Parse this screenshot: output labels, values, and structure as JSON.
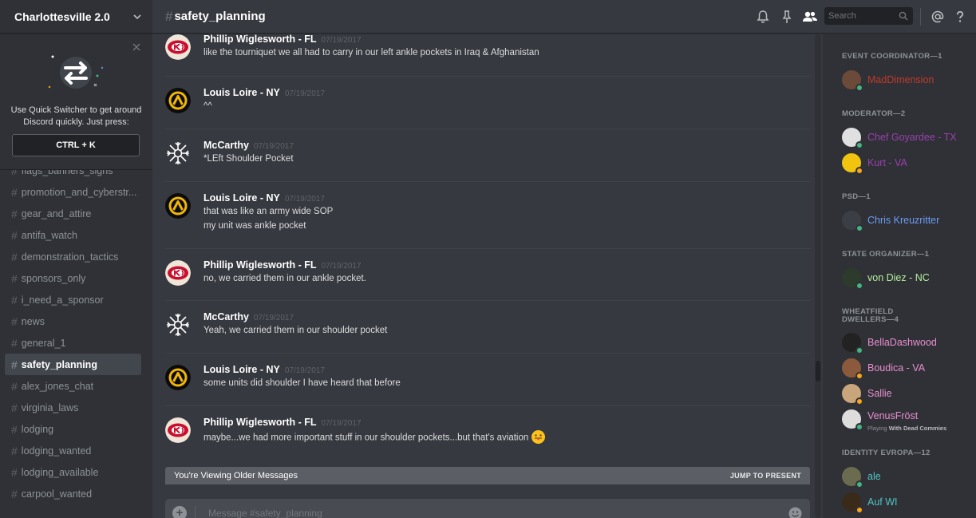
{
  "server": {
    "name": "Charlottesville 2.0"
  },
  "quick_switcher": {
    "text_line1": "Use Quick Switcher to get around",
    "text_line2": "Discord quickly. Just press:",
    "shortcut": "CTRL + K"
  },
  "channels": [
    {
      "name": "flags_banners_signs",
      "active": false
    },
    {
      "name": "promotion_and_cyberstr...",
      "active": false
    },
    {
      "name": "gear_and_attire",
      "active": false
    },
    {
      "name": "antifa_watch",
      "active": false
    },
    {
      "name": "demonstration_tactics",
      "active": false
    },
    {
      "name": "sponsors_only",
      "active": false
    },
    {
      "name": "i_need_a_sponsor",
      "active": false
    },
    {
      "name": "news",
      "active": false
    },
    {
      "name": "general_1",
      "active": false
    },
    {
      "name": "safety_planning",
      "active": true
    },
    {
      "name": "alex_jones_chat",
      "active": false
    },
    {
      "name": "virginia_laws",
      "active": false
    },
    {
      "name": "lodging",
      "active": false
    },
    {
      "name": "lodging_wanted",
      "active": false
    },
    {
      "name": "lodging_available",
      "active": false
    },
    {
      "name": "carpool_wanted",
      "active": false
    }
  ],
  "topbar": {
    "hash": "#",
    "channel_name": "safety_planning",
    "search_placeholder": "Search",
    "icons": [
      "bell-icon",
      "pin-icon",
      "members-icon",
      "search-icon",
      "at-icon",
      "help-icon"
    ]
  },
  "messages": [
    {
      "author": "Phillip Wiglesworth - FL",
      "avatar": "chiefs-logo",
      "timestamp": "07/19/2017",
      "lines": [
        "like the tourniquet we all had to carry in our left ankle pockets in Iraq & Afghanistan"
      ]
    },
    {
      "author": "Louis Loire - NY",
      "avatar": "lambda-logo",
      "timestamp": "07/19/2017",
      "lines": [
        "^^"
      ]
    },
    {
      "author": "McCarthy",
      "avatar": "snowflake-logo",
      "timestamp": "07/19/2017",
      "lines": [
        "*LEft Shoulder Pocket"
      ]
    },
    {
      "author": "Louis Loire - NY",
      "avatar": "lambda-logo",
      "timestamp": "07/19/2017",
      "lines": [
        "that was like an army wide SOP",
        "my unit was ankle pocket"
      ]
    },
    {
      "author": "Phillip Wiglesworth - FL",
      "avatar": "chiefs-logo",
      "timestamp": "07/19/2017",
      "lines": [
        "no, we carried them in our ankle pocket."
      ]
    },
    {
      "author": "McCarthy",
      "avatar": "snowflake-logo",
      "timestamp": "07/19/2017",
      "lines": [
        "Yeah, we carried them in our shoulder pocket"
      ]
    },
    {
      "author": "Louis Loire - NY",
      "avatar": "lambda-logo",
      "timestamp": "07/19/2017",
      "lines": [
        "some units did shoulder I have heard that before"
      ]
    },
    {
      "author": "Phillip Wiglesworth - FL",
      "avatar": "chiefs-logo",
      "timestamp": "07/19/2017",
      "lines": [
        "maybe...we had more important stuff in our shoulder pockets...but that's aviation"
      ],
      "emoji": "tongue-out-emoji"
    }
  ],
  "older_messages_bar": {
    "text": "You're Viewing Older Messages",
    "jump": "JUMP TO PRESENT"
  },
  "composer": {
    "placeholder": "Message #safety_planning"
  },
  "member_groups": [
    {
      "role": "EVENT COORDINATOR—1",
      "members": [
        {
          "name": "MadDimension",
          "color": "#c0392b",
          "status": "online"
        }
      ]
    },
    {
      "role": "MODERATOR—2",
      "members": [
        {
          "name": "Chef Goyardee - TX",
          "color": "#9b3fb0",
          "status": "online"
        },
        {
          "name": "Kurt - VA",
          "color": "#9b3fb0",
          "status": "idle"
        }
      ]
    },
    {
      "role": "PSD—1",
      "members": [
        {
          "name": "Chris Kreuzritter",
          "color": "#6d9bf2",
          "status": "online"
        }
      ]
    },
    {
      "role": "STATE ORGANIZER—1",
      "members": [
        {
          "name": "von Diez - NC",
          "color": "#b6f09c",
          "status": "online"
        }
      ]
    },
    {
      "role": "WHEATFIELD DWELLERS—4",
      "members": [
        {
          "name": "BellaDashwood",
          "color": "#e98ed0",
          "status": "online"
        },
        {
          "name": "Boudica - VA",
          "color": "#e98ed0",
          "status": "idle"
        },
        {
          "name": "Sallie",
          "color": "#e98ed0",
          "status": "idle"
        },
        {
          "name": "VenusFröst",
          "color": "#e98ed0",
          "status": "online",
          "playing_prefix": "Playing ",
          "playing": "With Dead Commies"
        }
      ]
    },
    {
      "role": "IDENTITY EVROPA—12",
      "members": [
        {
          "name": "ale",
          "color": "#4fc3c5",
          "status": "online"
        },
        {
          "name": "Auf WI",
          "color": "#4fc3c5",
          "status": "idle"
        }
      ]
    }
  ],
  "colors": {
    "online": "#43b581",
    "idle": "#faa61a",
    "accent": "#7289da"
  }
}
